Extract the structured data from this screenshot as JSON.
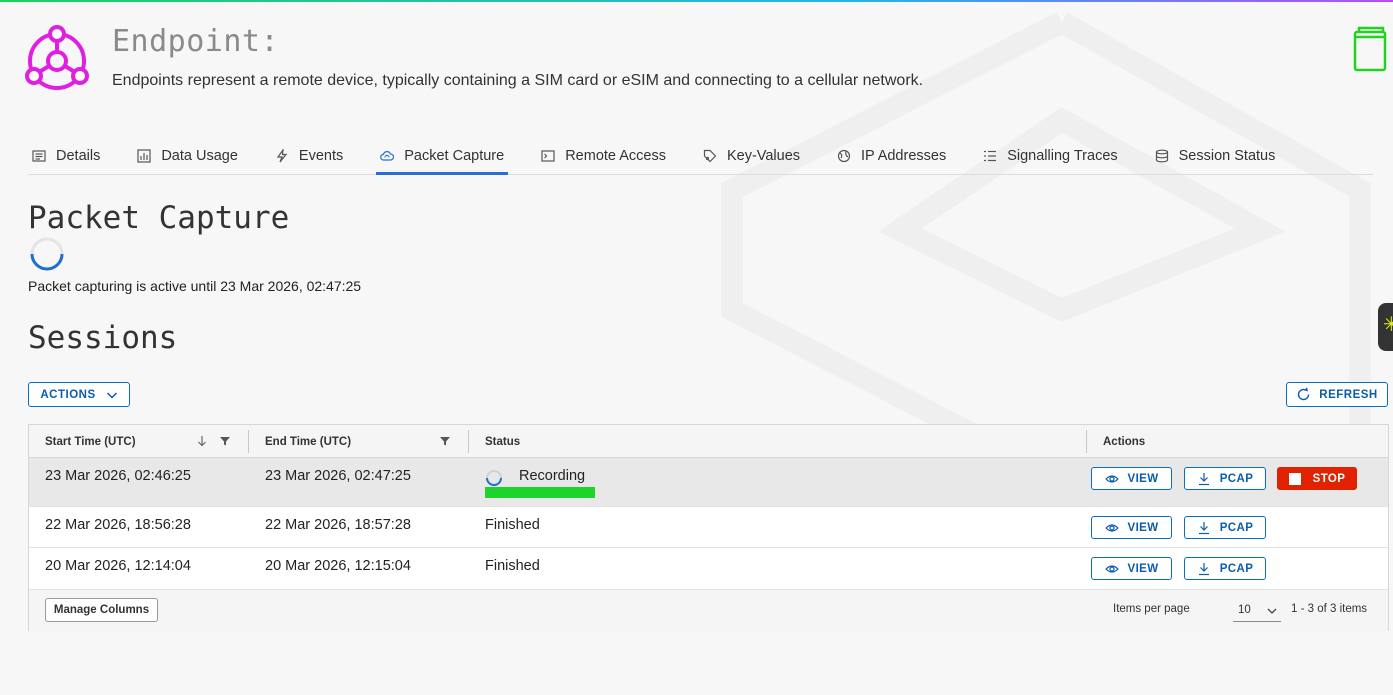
{
  "header": {
    "title": "Endpoint:",
    "description": "Endpoints represent a remote device, typically containing a SIM card or eSIM and connecting to a cellular network."
  },
  "tabs": [
    {
      "label": "Details",
      "icon": "details-icon"
    },
    {
      "label": "Data Usage",
      "icon": "chart-icon"
    },
    {
      "label": "Events",
      "icon": "lightning-icon"
    },
    {
      "label": "Packet Capture",
      "icon": "cloud-sync-icon",
      "active": true
    },
    {
      "label": "Remote Access",
      "icon": "terminal-icon"
    },
    {
      "label": "Key-Values",
      "icon": "tag-icon"
    },
    {
      "label": "IP Addresses",
      "icon": "globe-icon"
    },
    {
      "label": "Signalling Traces",
      "icon": "list-icon"
    },
    {
      "label": "Session Status",
      "icon": "database-icon"
    }
  ],
  "capture": {
    "heading": "Packet Capture",
    "active_text": "Packet capturing is active until 23 Mar 2026, 02:47:25"
  },
  "sessions": {
    "heading": "Sessions",
    "actions_label": "ACTIONS",
    "refresh_label": "REFRESH",
    "columns": [
      "Start Time (UTC)",
      "End Time (UTC)",
      "Status",
      "Actions"
    ],
    "rows": [
      {
        "start": "23 Mar 2026, 02:46:25",
        "end": "23 Mar 2026, 02:47:25",
        "status": "Recording",
        "progress": 0.2,
        "selected": true
      },
      {
        "start": "22 Mar 2026, 18:56:28",
        "end": "22 Mar 2026, 18:57:28",
        "status": "Finished"
      },
      {
        "start": "20 Mar 2026, 12:14:04",
        "end": "20 Mar 2026, 12:15:04",
        "status": "Finished"
      }
    ],
    "view_label": "VIEW",
    "pcap_label": "PCAP",
    "stop_label": "STOP"
  },
  "footer": {
    "manage_columns_label": "Manage Columns",
    "items_per_page_label": "Items per page",
    "items_per_page_value": "10",
    "range_text": "1 - 3 of 3 items"
  },
  "colors": {
    "accent": "#2c6ed5",
    "logo": "#e020e0",
    "stop": "#e02200",
    "progress": "#1ed42a",
    "book": "#21d221"
  }
}
